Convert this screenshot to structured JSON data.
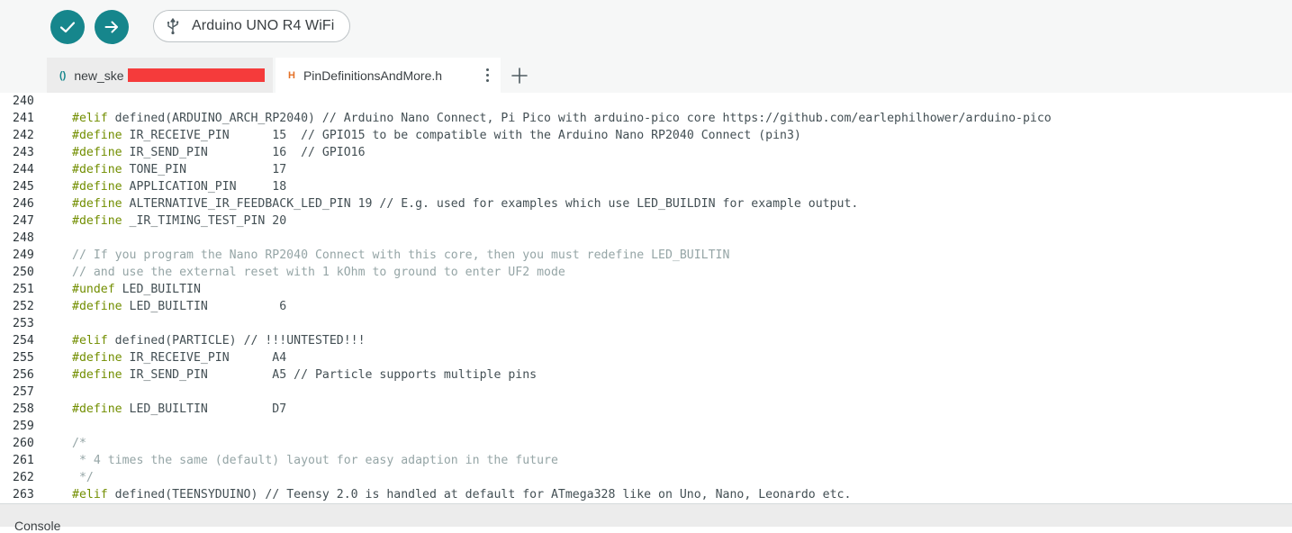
{
  "toolbar": {
    "verify_icon": "check-icon",
    "upload_icon": "arrow-right-icon",
    "board_name": "Arduino UNO R4 WiFi",
    "accent": "#16868c"
  },
  "tabs": [
    {
      "icon": "()",
      "label": "new_ske"
    },
    {
      "icon": "H",
      "label": "PinDefinitionsAndMore.h"
    }
  ],
  "editor": {
    "lines": [
      {
        "num": "240",
        "code": "",
        "kind": "code"
      },
      {
        "num": "241",
        "code": "#elif defined(ARDUINO_ARCH_RP2040) // Arduino Nano Connect, Pi Pico with arduino-pico core https://github.com/earlephilhower/arduino-pico",
        "kind": "code"
      },
      {
        "num": "242",
        "code": "#define IR_RECEIVE_PIN      15  // GPIO15 to be compatible with the Arduino Nano RP2040 Connect (pin3)",
        "kind": "code"
      },
      {
        "num": "243",
        "code": "#define IR_SEND_PIN         16  // GPIO16",
        "kind": "code"
      },
      {
        "num": "244",
        "code": "#define TONE_PIN            17",
        "kind": "code"
      },
      {
        "num": "245",
        "code": "#define APPLICATION_PIN     18",
        "kind": "code"
      },
      {
        "num": "246",
        "code": "#define ALTERNATIVE_IR_FEEDBACK_LED_PIN 19 // E.g. used for examples which use LED_BUILDIN for example output.",
        "kind": "code"
      },
      {
        "num": "247",
        "code": "#define _IR_TIMING_TEST_PIN 20",
        "kind": "code"
      },
      {
        "num": "248",
        "code": "",
        "kind": "code"
      },
      {
        "num": "249",
        "code": "// If you program the Nano RP2040 Connect with this core, then you must redefine LED_BUILTIN",
        "kind": "comment"
      },
      {
        "num": "250",
        "code": "// and use the external reset with 1 kOhm to ground to enter UF2 mode",
        "kind": "comment"
      },
      {
        "num": "251",
        "code": "#undef LED_BUILTIN",
        "kind": "code"
      },
      {
        "num": "252",
        "code": "#define LED_BUILTIN          6",
        "kind": "code"
      },
      {
        "num": "253",
        "code": "",
        "kind": "code"
      },
      {
        "num": "254",
        "code": "#elif defined(PARTICLE) // !!!UNTESTED!!!",
        "kind": "code"
      },
      {
        "num": "255",
        "code": "#define IR_RECEIVE_PIN      A4",
        "kind": "code"
      },
      {
        "num": "256",
        "code": "#define IR_SEND_PIN         A5 // Particle supports multiple pins",
        "kind": "code"
      },
      {
        "num": "257",
        "code": "",
        "kind": "code"
      },
      {
        "num": "258",
        "code": "#define LED_BUILTIN         D7",
        "kind": "code"
      },
      {
        "num": "259",
        "code": "",
        "kind": "code"
      },
      {
        "num": "260",
        "code": "/*",
        "kind": "comment"
      },
      {
        "num": "261",
        "code": " * 4 times the same (default) layout for easy adaption in the future",
        "kind": "comment"
      },
      {
        "num": "262",
        "code": " */",
        "kind": "comment"
      },
      {
        "num": "263",
        "code": "#elif defined(TEENSYDUINO) // Teensy 2.0 is handled at default for ATmega328 like on Uno, Nano, Leonardo etc.",
        "kind": "code"
      }
    ]
  },
  "console": {
    "label": "Console"
  }
}
